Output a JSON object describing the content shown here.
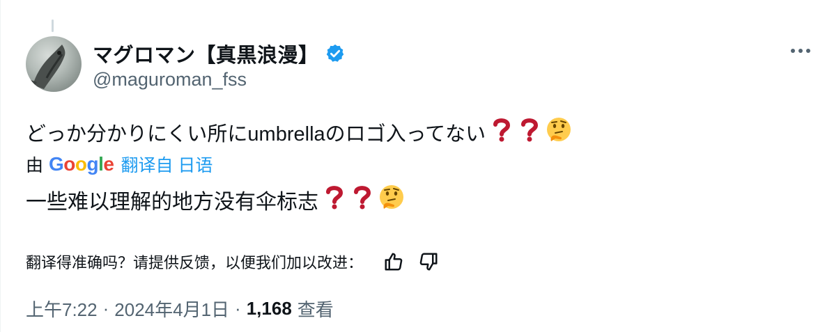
{
  "author": {
    "display_name": "マグロマン【真黒浪漫】",
    "handle": "@maguroman_fss",
    "verified": true,
    "verified_color": "#1d9bf0"
  },
  "tweet": {
    "text": "どっか分かりにくい所にumbrellaのロゴ入ってない",
    "trailing_emoji": [
      "red-question-mark",
      "red-question-mark",
      "thinking-face"
    ]
  },
  "translation_bar": {
    "by_label": "由",
    "provider": "Google",
    "link_text": "翻译自 日语",
    "link_color": "#1d9bf0"
  },
  "translation": {
    "text": "一些难以理解的地方没有伞标志",
    "trailing_emoji": [
      "red-question-mark",
      "red-question-mark",
      "thinking-face"
    ]
  },
  "feedback": {
    "prompt": "翻译得准确吗？请提供反馈，以便我们加以改进："
  },
  "meta": {
    "time": "上午7:22",
    "separator": "·",
    "date": "2024年4月1日",
    "views_count": "1,168",
    "views_label": "查看"
  }
}
